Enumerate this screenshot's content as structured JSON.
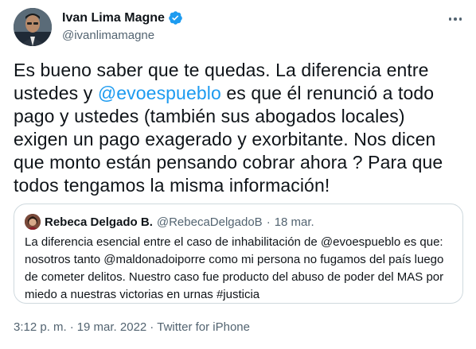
{
  "author": {
    "name": "Ivan Lima Magne",
    "handle": "@ivanlimamagne"
  },
  "tweet": {
    "text_before": "Es bueno saber que te quedas. La diferencia entre ustedes y ",
    "mention": "@evoespueblo",
    "text_after": " es que él renunció a todo pago y ustedes (también sus abogados locales) exigen un pago exagerado y exorbitante. Nos dicen que monto están pensando cobrar ahora ? Para que todos tengamos la misma información!"
  },
  "quote": {
    "name": "Rebeca Delgado B.",
    "handle": "@RebecaDelgadoB",
    "separator": "·",
    "date": "18 mar.",
    "text": "La diferencia esencial entre el caso de inhabilitación de @evoespueblo es que: nosotros tanto @maldonadoiporre como mi persona no fugamos del país luego de cometer delitos. Nuestro caso fue producto del abuso de poder del MAS por miedo a nuestras victorias en urnas #justicia"
  },
  "meta": {
    "time": "3:12 p. m.",
    "separator1": "·",
    "date": "19 mar. 2022",
    "separator2": "·",
    "source": "Twitter for iPhone"
  },
  "icons": {
    "verified": "verified-badge-icon",
    "more": "more-options-icon"
  },
  "colors": {
    "accent": "#1d9bf0",
    "secondary_text": "#536471",
    "border": "#cfd9de"
  }
}
